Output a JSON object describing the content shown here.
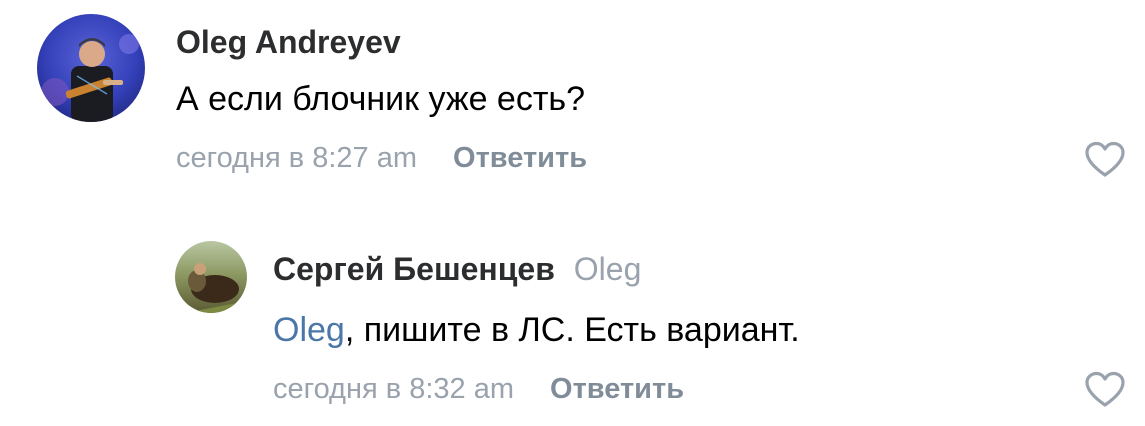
{
  "comments": [
    {
      "author": "Oleg Andreyev",
      "text": "А если блочник уже есть?",
      "time": "сегодня в 8:27 am",
      "reply_label": "Ответить"
    },
    {
      "author": "Сергей Бешенцев",
      "reply_to": "Oleg",
      "mention": "Oleg",
      "text": ", пишите в ЛС. Есть вариант.",
      "time": "сегодня в 8:32 am",
      "reply_label": "Ответить"
    }
  ],
  "colors": {
    "author": "#2c2d2e",
    "meta": "#99a2ad",
    "reply": "#818c99",
    "mention": "#4a76a8",
    "like_icon": "#99a2ad"
  },
  "icons": {
    "like": "heart-outline-icon"
  }
}
